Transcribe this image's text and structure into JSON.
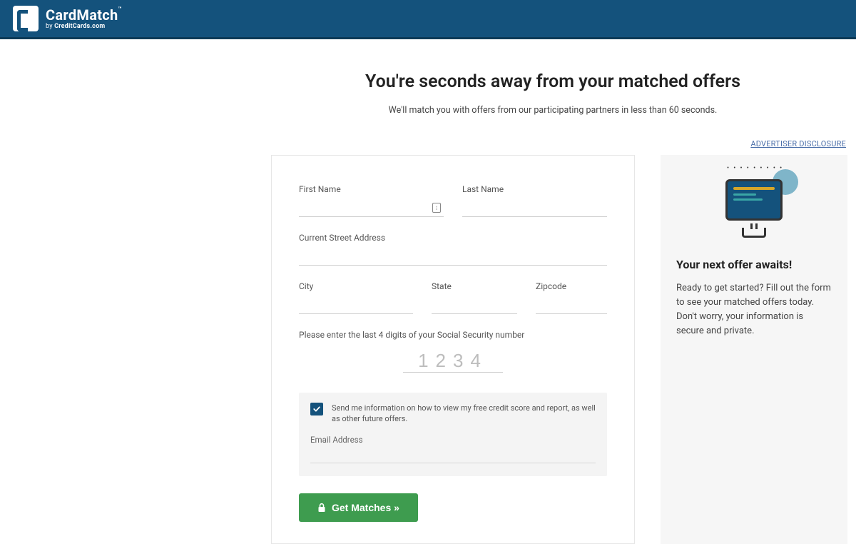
{
  "header": {
    "brand": "CardMatch",
    "trademark": "™",
    "byline_prefix": "by ",
    "byline_bold": "CreditCards.com"
  },
  "page": {
    "headline": "You're seconds away from your matched offers",
    "subhead": "We'll match you with offers from our participating partners in less than 60 seconds.",
    "disclosure": "ADVERTISER DISCLOSURE"
  },
  "form": {
    "first_name_label": "First Name",
    "last_name_label": "Last Name",
    "street_label": "Current Street Address",
    "city_label": "City",
    "state_label": "State",
    "zip_label": "Zipcode",
    "ssn_label": "Please enter the last 4 digits of your Social Security number",
    "ssn_placeholder": "1234",
    "opt_in_text": "Send me information on how to view my free credit score and report, as well as other future offers.",
    "opt_in_checked": true,
    "email_label": "Email Address",
    "submit_label": "Get Matches »"
  },
  "sidebar": {
    "title": "Your next offer awaits!",
    "body": "Ready to get started? Fill out the form to see your matched offers today. Don't worry, your information is secure and private."
  },
  "colors": {
    "header_bg": "#14527c",
    "button_bg": "#3e9c4f"
  }
}
